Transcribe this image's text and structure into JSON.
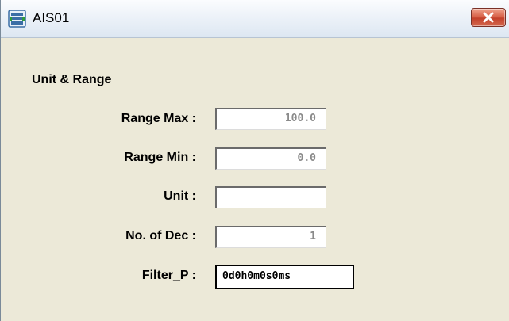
{
  "window": {
    "title": "AIS01",
    "icon": "tag-icon",
    "close_icon": "close-icon",
    "close_color": "#d05a41"
  },
  "section": {
    "title": "Unit & Range"
  },
  "fields": [
    {
      "label": "Range Max :",
      "value": "100.0"
    },
    {
      "label": "Range Min :",
      "value": "0.0"
    },
    {
      "label": "Unit :",
      "value": ""
    },
    {
      "label": "No. of Dec :",
      "value": "1"
    },
    {
      "label": "Filter_P :",
      "value": "0d0h0m0s0ms"
    }
  ]
}
